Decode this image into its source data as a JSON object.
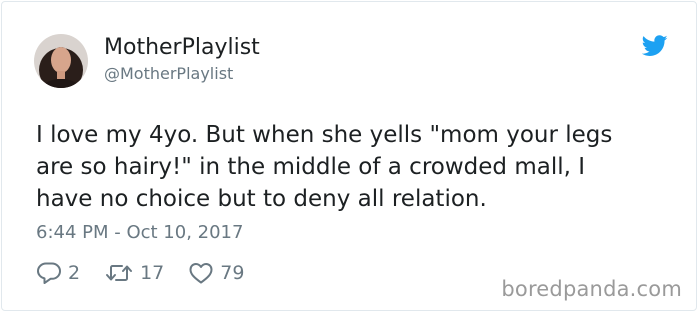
{
  "tweet": {
    "display_name": "MotherPlaylist",
    "handle": "@MotherPlaylist",
    "text_lines": [
      "I love my 4yo. But when she yells \"mom your legs",
      "are so hairy!\" in the middle of a crowded mall, I",
      "have no choice but to deny all relation."
    ],
    "timestamp": "6:44 PM - Oct 10, 2017",
    "reply_count": "2",
    "retweet_count": "17",
    "like_count": "79",
    "icons": {
      "brand": "twitter-bird-icon",
      "reply": "reply-bubble-icon",
      "retweet": "retweet-icon",
      "like": "heart-icon"
    }
  },
  "watermark": {
    "text": "boredpanda.com"
  },
  "colors": {
    "text": "#1c2022",
    "muted": "#697882",
    "twitter_blue": "#1da1f2",
    "border": "#e1e8ed",
    "watermark": "#9a9a9a"
  }
}
